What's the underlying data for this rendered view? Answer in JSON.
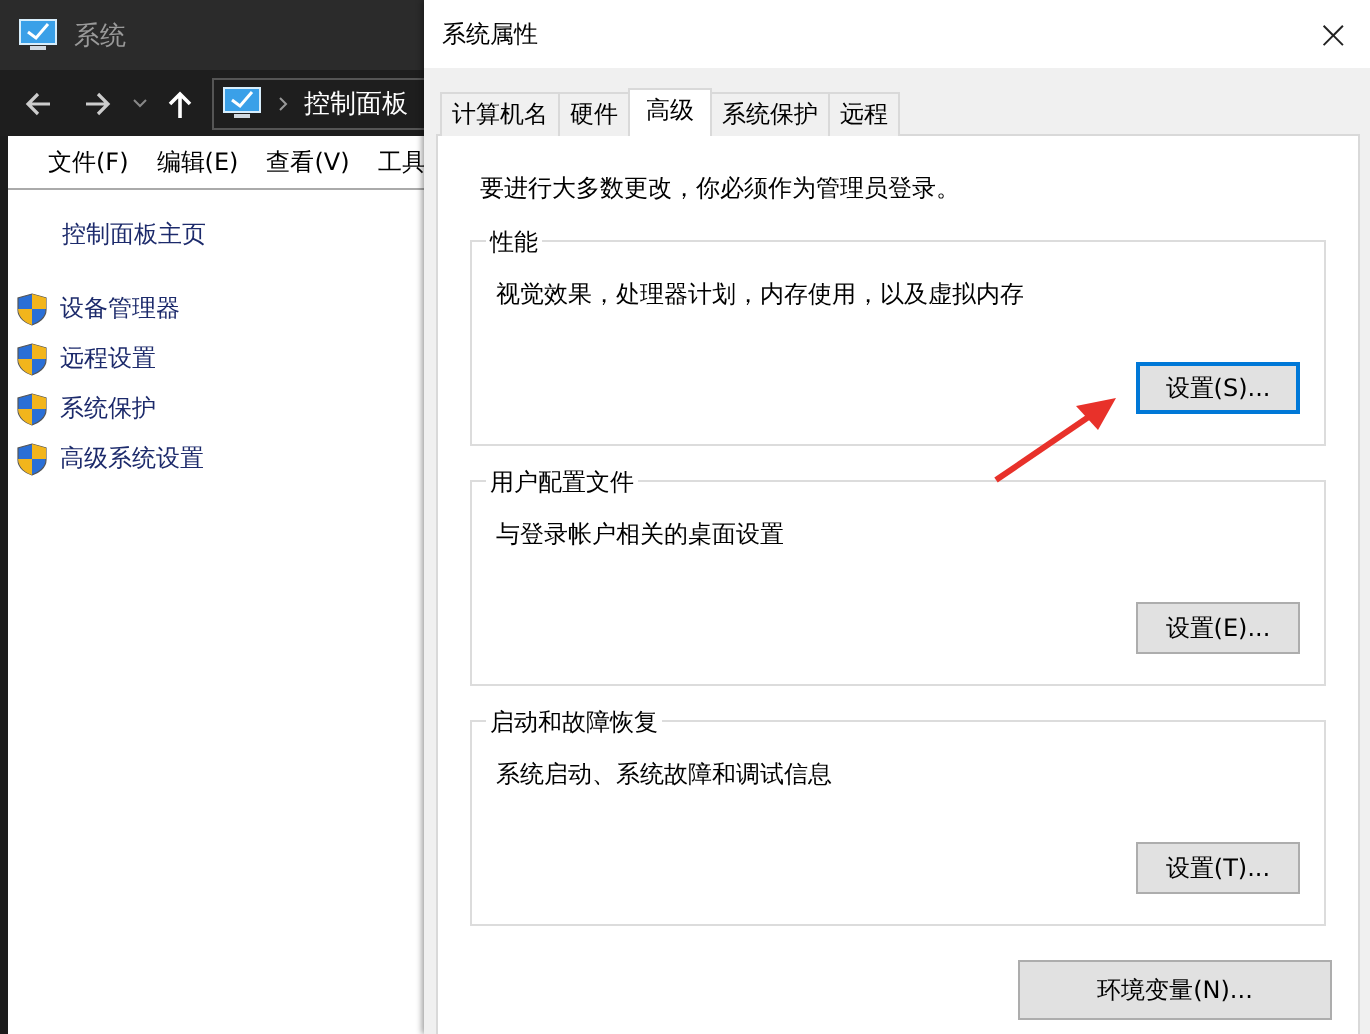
{
  "explorer": {
    "title": "系统",
    "address": "控制面板",
    "menu": [
      "文件(F)",
      "编辑(E)",
      "查看(V)",
      "工具"
    ],
    "sidebar_home": "控制面板主页",
    "sidebar_links": [
      "设备管理器",
      "远程设置",
      "系统保护",
      "高级系统设置"
    ]
  },
  "dialog": {
    "title": "系统属性",
    "close": "×",
    "tabs": [
      {
        "label": "计算机名",
        "selected": false
      },
      {
        "label": "硬件",
        "selected": false
      },
      {
        "label": "高级",
        "selected": true
      },
      {
        "label": "系统保护",
        "selected": false
      },
      {
        "label": "远程",
        "selected": false
      }
    ],
    "notice": "要进行大多数更改，你必须作为管理员登录。",
    "groups": [
      {
        "title": "性能",
        "description": "视觉效果，处理器计划，内存使用，以及虚拟内存",
        "button": "设置(S)...",
        "focused": true
      },
      {
        "title": "用户配置文件",
        "description": "与登录帐户相关的桌面设置",
        "button": "设置(E)...",
        "focused": false
      },
      {
        "title": "启动和故障恢复",
        "description": "系统启动、系统故障和调试信息",
        "button": "设置(T)...",
        "focused": false
      }
    ],
    "bottom_button": "环境变量(N)..."
  }
}
